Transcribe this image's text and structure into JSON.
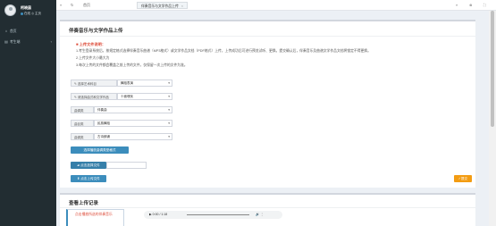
{
  "user": {
    "name": "柯晓晨",
    "status": "在线",
    "status_extra": "◎ 主页"
  },
  "sidebar": {
    "items": [
      {
        "label": "首页",
        "icon": "home-icon"
      },
      {
        "label": "考生端",
        "icon": "folder-icon"
      }
    ]
  },
  "header": {
    "home_tab": "首页",
    "active_tab": "伴奏音乐与文学作品上传",
    "close_glyph": "×"
  },
  "form": {
    "title": "伴奏音乐与文学作品上传",
    "notice_title": "上传文件说明：",
    "notes": [
      "1.考生登录系统后，按规定格式选择伴奏音乐曲谱（MP3格式）或文学作品文档（PDF格式）上传，上传成功后可进行预览试听、更换。提交确认后，伴奏音乐及曲谱文学作品文档将锁定不得更换。",
      "2.上传文件大小最大为",
      "3.每次上传的文件都会覆盖之前上传的文件，仅保留一次上传的文件为准。"
    ],
    "fields": [
      {
        "label": "选择艺术科目",
        "value": "舞蹈表演"
      },
      {
        "label": "请选择曲式和文学作品",
        "value": "十面埋伏"
      },
      {
        "label": "曲调类",
        "value": "伴奏曲"
      },
      {
        "label": "曲目类",
        "value": "民族舞蹈"
      },
      {
        "label": "曲调类",
        "value": "古诗朗诵"
      }
    ],
    "action_button": "选择播放曲调类型格式",
    "file_button": "点击选择文件",
    "upload_button": "点击上传文件",
    "submit_button": "✓提交"
  },
  "records": {
    "title": "查看上传记录",
    "item_text": "点击播放所选的伴奏音乐",
    "audio_time": "▶ 0:00 / 1:18",
    "audio_controls": "🔊 ⋮"
  },
  "colors": {
    "sidebar_bg": "#222d32",
    "primary": "#3c8dbc",
    "accent_red": "#dd4b39",
    "submit": "#f39c12"
  }
}
